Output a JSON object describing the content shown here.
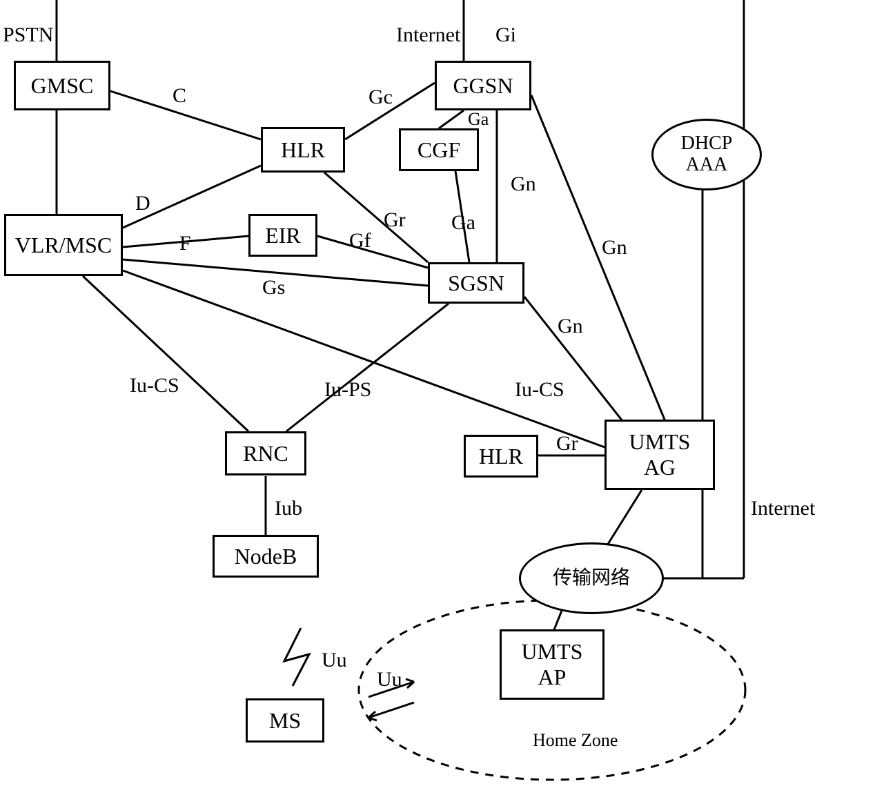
{
  "nodes": {
    "gmsc": "GMSC",
    "hlr": "HLR",
    "ggsn": "GGSN",
    "cgf": "CGF",
    "dhcp_aaa": "DHCP\nAAA",
    "eir": "EIR",
    "vlr_msc": "VLR/MSC",
    "sgsn": "SGSN",
    "umts_ag": "UMTS\nAG",
    "rnc": "RNC",
    "hlr2": "HLR",
    "nodeb": "NodeB",
    "transport_network": "传输网络",
    "umts_ap": "UMTS\nAP",
    "ms": "MS"
  },
  "labels": {
    "pstn": "PSTN",
    "internet_top": "Internet",
    "gi": "Gi",
    "c": "C",
    "gc": "Gc",
    "ga_top": "Ga",
    "gn1": "Gn",
    "d": "D",
    "gr": "Gr",
    "ga_mid": "Ga",
    "gn2": "Gn",
    "f": "F",
    "gf": "Gf",
    "gs": "Gs",
    "gn3": "Gn",
    "iu_cs1": "Iu-CS",
    "iu_ps": "Iu-PS",
    "iu_cs2": "Iu-CS",
    "gr2": "Gr",
    "internet_right": "Internet",
    "iub": "Iub",
    "uu": "Uu",
    "uu2": "Uu",
    "home_zone": "Home Zone"
  }
}
